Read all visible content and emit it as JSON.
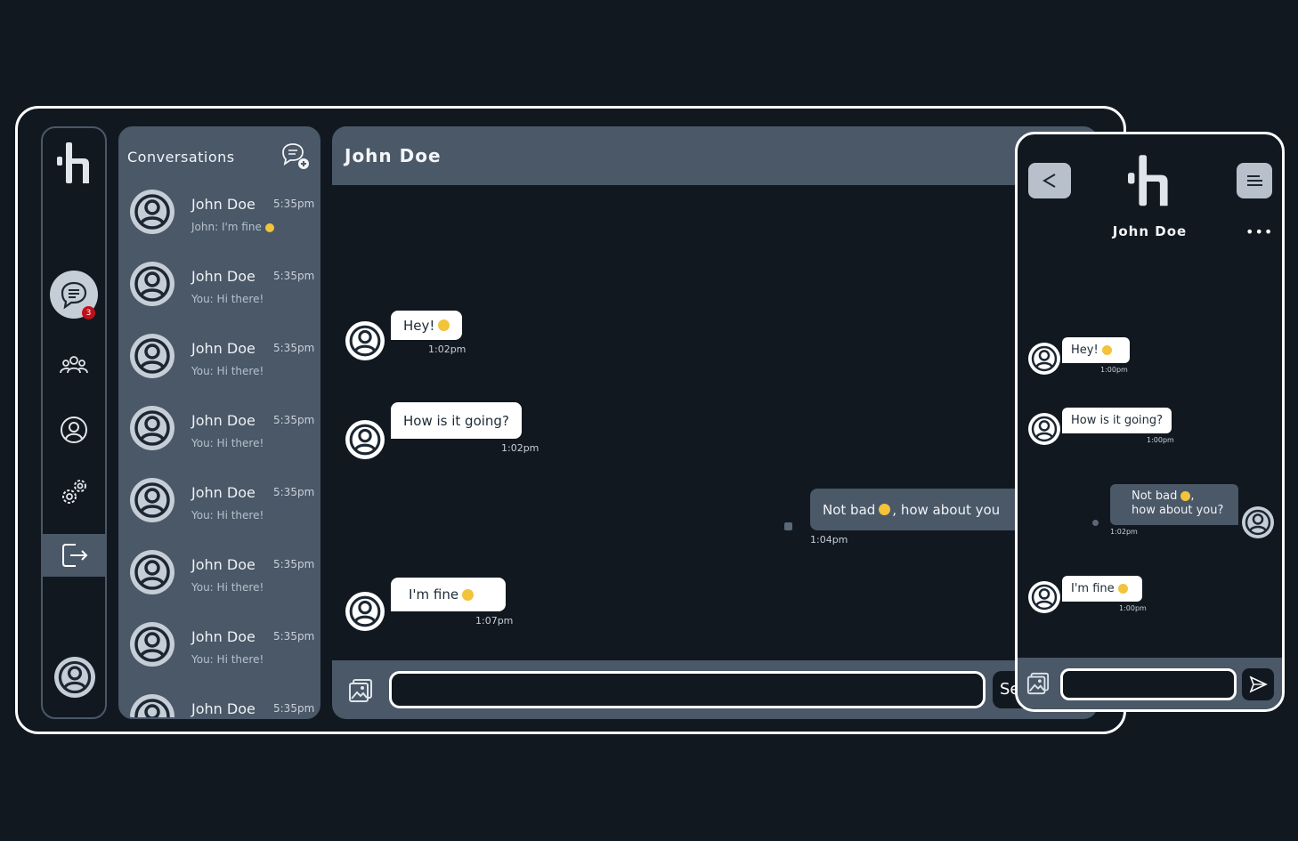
{
  "sidebar": {
    "badge_count": "3"
  },
  "conversations": {
    "title": "Conversations",
    "items": [
      {
        "name": "John Doe",
        "time": "5:35pm",
        "preview": "John: I'm fine"
      },
      {
        "name": "John Doe",
        "time": "5:35pm",
        "preview": "You: Hi there!"
      },
      {
        "name": "John Doe",
        "time": "5:35pm",
        "preview": "You: Hi there!"
      },
      {
        "name": "John Doe",
        "time": "5:35pm",
        "preview": "You: Hi there!"
      },
      {
        "name": "John Doe",
        "time": "5:35pm",
        "preview": "You: Hi there!"
      },
      {
        "name": "John Doe",
        "time": "5:35pm",
        "preview": "You: Hi there!"
      },
      {
        "name": "John Doe",
        "time": "5:35pm",
        "preview": "You: Hi there!"
      },
      {
        "name": "John Doe",
        "time": "5:35pm",
        "preview": ""
      }
    ]
  },
  "chat": {
    "title": "John Doe",
    "send_label": "Se",
    "messages": [
      {
        "text": "Hey!",
        "time": "1:02pm",
        "direction": "in"
      },
      {
        "text": "How is it going?",
        "time": "1:02pm",
        "direction": "in"
      },
      {
        "text_before": "Not bad",
        "text_after": ", how about you",
        "time": "1:04pm",
        "direction": "out"
      },
      {
        "text": "I'm fine",
        "time": "1:07pm",
        "direction": "in"
      }
    ]
  },
  "mobile": {
    "title": "John Doe",
    "more": "•••",
    "messages": [
      {
        "text": "Hey!",
        "time": "1:00pm"
      },
      {
        "text": "How is it going?",
        "time": "1:00pm"
      },
      {
        "line1": "Not bad",
        "line1_suffix": ",",
        "line2": "how about you?",
        "time": "1:02pm"
      },
      {
        "text": "I'm fine",
        "time": "1:00pm"
      }
    ]
  },
  "colors": {
    "panel": "#4a5868",
    "background": "#111820",
    "badge": "#c0101b"
  }
}
